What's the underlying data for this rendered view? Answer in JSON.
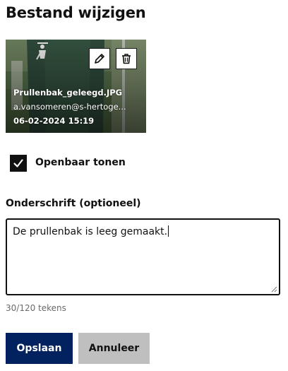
{
  "page": {
    "title": "Bestand wijzigen"
  },
  "file": {
    "name": "Prullenbak_geleegd.JPG",
    "uploader": "a.vansomeren@s-hertoge...",
    "date": "06-02-2024 15:19",
    "icons": {
      "edit": "pencil-icon",
      "delete": "trash-icon"
    }
  },
  "visibility": {
    "label": "Openbaar tonen",
    "checked": true
  },
  "caption": {
    "label": "Onderschrift (optioneel)",
    "value": "De prullenbak is leeg gemaakt.",
    "counter": "30/120 tekens"
  },
  "actions": {
    "save_label": "Opslaan",
    "cancel_label": "Annuleer"
  },
  "colors": {
    "primary": "#01225e",
    "secondary": "#bfbfbf",
    "text": "#111111",
    "muted": "#6b6b6b"
  }
}
